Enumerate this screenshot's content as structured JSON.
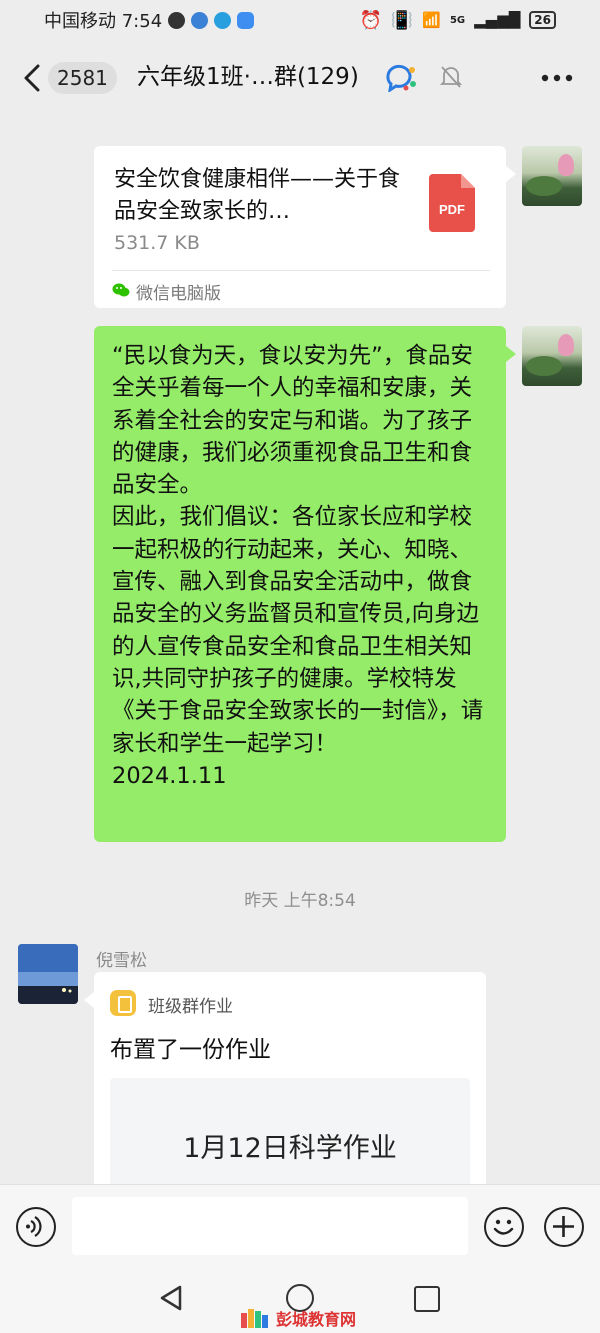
{
  "status_bar": {
    "carrier_time": "中国移动 7:54",
    "network": "5G",
    "battery": "26"
  },
  "header": {
    "back_count": "2581",
    "title": "六年级1班·…群(129)"
  },
  "file_message": {
    "file_name": "安全饮食健康相伴——关于食品安全致家长的…",
    "file_size": "531.7 KB",
    "file_type": "PDF",
    "source": "微信电脑版"
  },
  "text_message": {
    "text": "“民以食为天，食以安为先”，食品安全关乎着每一个人的幸福和安康，关系着全社会的安定与和谐。为了孩子的健康，我们必须重视食品卫生和食品安全。\n因此，我们倡议：各位家长应和学校一起积极的行动起来，关心、知晓、宣传、融入到食品安全活动中，做食品安全的义务监督员和宣传员,向身边的人宣传食品安全和食品卫生相关知识,共同守护孩子的健康。学校特发《关于食品安全致家长的一封信》，请家长和学生一起学习！\n2024.1.11"
  },
  "timestamp": "昨天 上午8:54",
  "homework_message": {
    "sender": "倪雪松",
    "app_name": "班级群作业",
    "title": "布置了一份作业",
    "inner_title": "1月12日科学作业"
  },
  "watermark": "彭城教育网",
  "colors": {
    "bubble_green": "#95ec69",
    "chat_background": "#ededed",
    "pdf_red": "#e8514a"
  }
}
